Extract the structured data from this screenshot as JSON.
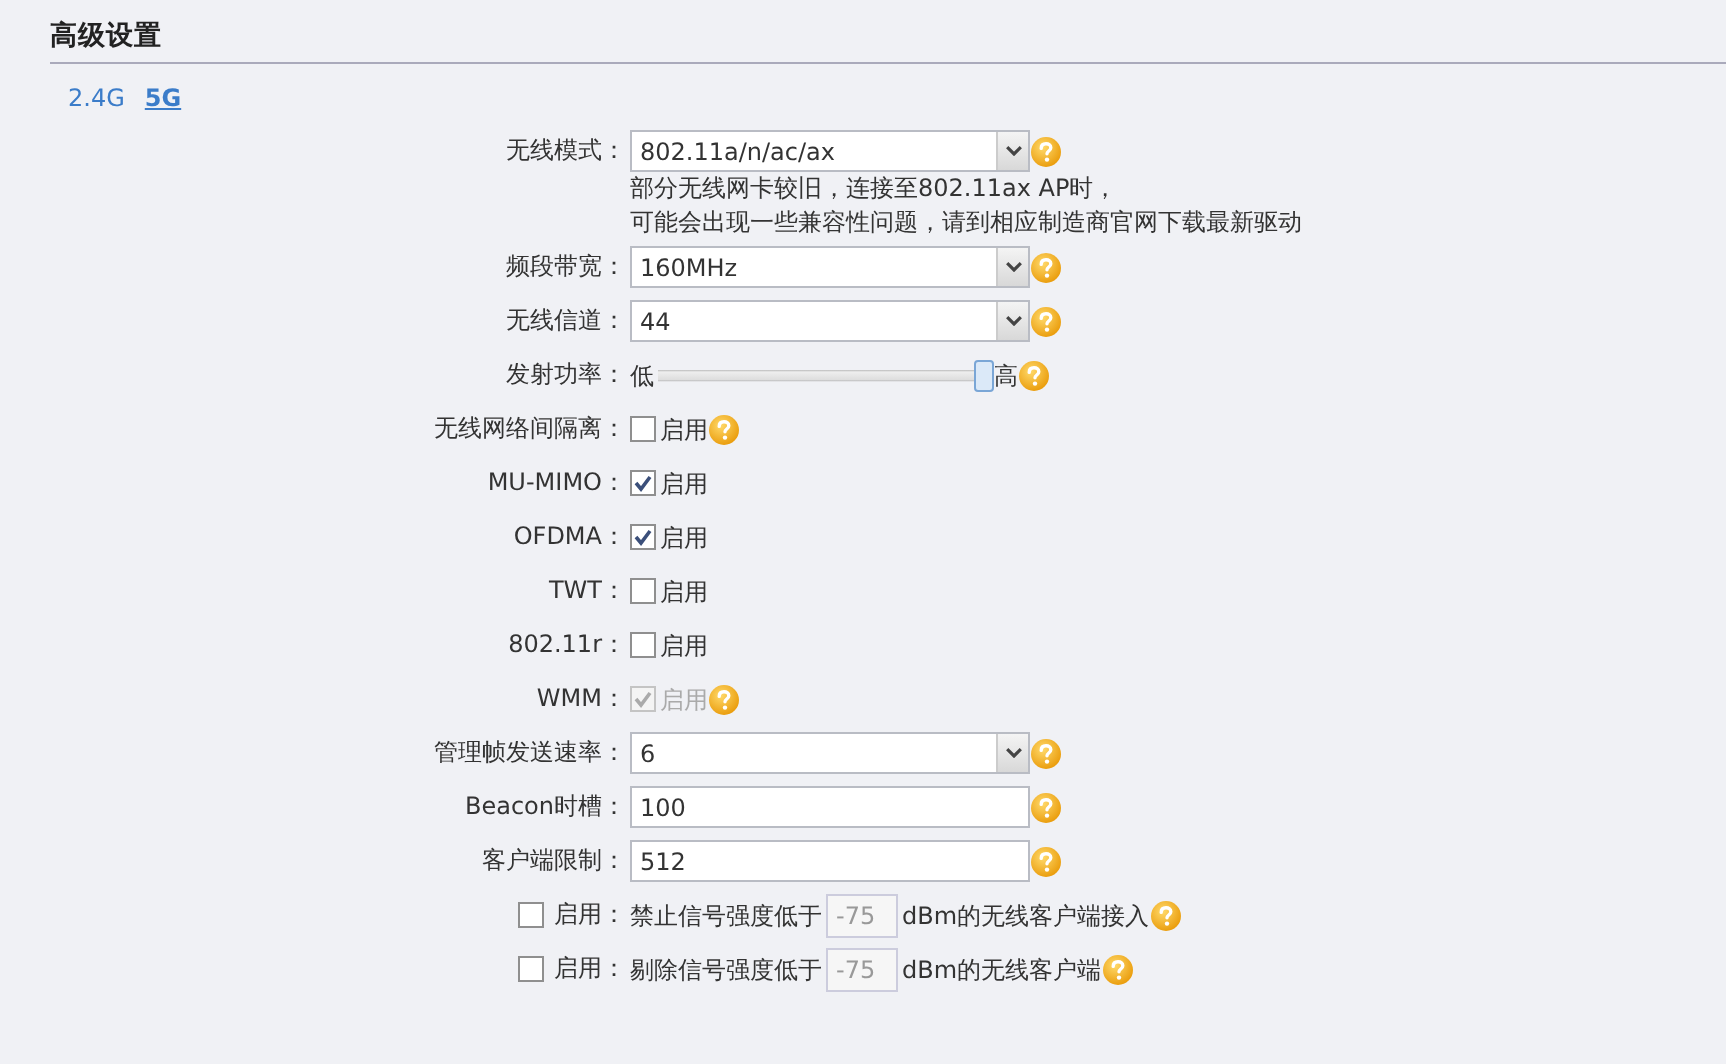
{
  "section_title": "高级设置",
  "bands": [
    {
      "label": "2.4G",
      "selected": false
    },
    {
      "label": "5G",
      "selected": true
    }
  ],
  "rows": [
    {
      "kind": "select",
      "label": "无线模式：",
      "value": "802.11a/n/ac/ax",
      "help": true,
      "notes": [
        "部分无线网卡较旧，连接至802.11ax AP时，",
        "可能会出现一些兼容性问题，请到相应制造商官网下载最新驱动"
      ]
    },
    {
      "kind": "select",
      "label": "频段带宽：",
      "value": "160MHz",
      "help": true
    },
    {
      "kind": "select",
      "label": "无线信道：",
      "value": "44",
      "help": true
    },
    {
      "kind": "slider",
      "label": "发射功率：",
      "low": "低",
      "high": "高",
      "level": 0.98,
      "help": true
    },
    {
      "kind": "checkbox",
      "label": "无线网络间隔离：",
      "text": "启用",
      "checked": false,
      "disabled": false,
      "help": true
    },
    {
      "kind": "checkbox",
      "label": "MU-MIMO：",
      "text": "启用",
      "checked": true,
      "disabled": false,
      "help": false
    },
    {
      "kind": "checkbox",
      "label": "OFDMA：",
      "text": "启用",
      "checked": true,
      "disabled": false,
      "help": false
    },
    {
      "kind": "checkbox",
      "label": "TWT：",
      "text": "启用",
      "checked": false,
      "disabled": false,
      "help": false
    },
    {
      "kind": "checkbox",
      "label": "802.11r：",
      "text": "启用",
      "checked": false,
      "disabled": false,
      "help": false
    },
    {
      "kind": "checkbox",
      "label": "WMM：",
      "text": "启用",
      "checked": true,
      "disabled": true,
      "help": true
    },
    {
      "kind": "select",
      "label": "管理帧发送速率：",
      "value": "6",
      "help": true
    },
    {
      "kind": "text",
      "label": "Beacon时槽：",
      "value": "100",
      "help": true
    },
    {
      "kind": "text",
      "label": "客户端限制：",
      "value": "512",
      "help": true
    },
    {
      "kind": "threshold",
      "label": "启用：",
      "checked": false,
      "before": "禁止信号强度低于",
      "value": "-75",
      "disabled": true,
      "after": "dBm的无线客户端接入",
      "help": true
    },
    {
      "kind": "threshold",
      "label": "启用：",
      "checked": false,
      "before": "剔除信号强度低于",
      "value": "-75",
      "disabled": true,
      "after": "dBm的无线客户端",
      "help": true
    }
  ]
}
